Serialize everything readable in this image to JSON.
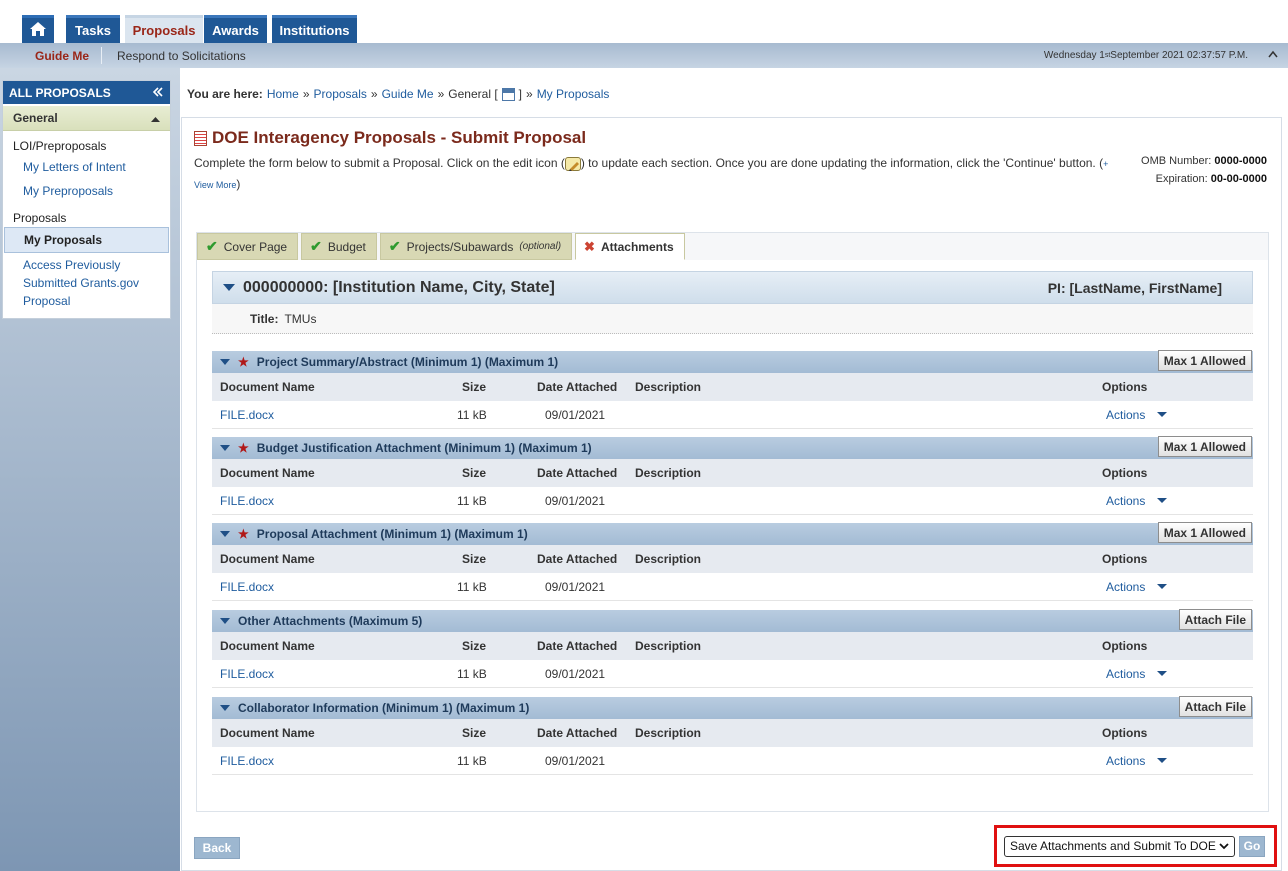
{
  "topnav": {
    "tabs": [
      {
        "label": "Tasks"
      },
      {
        "label": "Proposals"
      },
      {
        "label": "Awards"
      },
      {
        "label": "Institutions"
      }
    ]
  },
  "subnav": {
    "guide_me": "Guide Me",
    "respond": "Respond to Solicitations",
    "date_prefix": "Wednesday 1",
    "date_sup": "st",
    "date_suffix": " September 2021 02:37:57 P.M."
  },
  "sidebar": {
    "header": "ALL PROPOSALS",
    "section": "General",
    "groups": [
      {
        "label": "LOI/Preproposals",
        "links": [
          "My Letters of Intent",
          "My Preproposals"
        ]
      },
      {
        "label": "Proposals",
        "links": [
          "My Proposals",
          "Access Previously Submitted Grants.gov Proposal"
        ]
      }
    ]
  },
  "breadcrumb": {
    "label": "You are here:",
    "items": [
      "Home",
      "Proposals",
      "Guide Me"
    ],
    "general": "General [",
    "general_close": "]",
    "last": "My Proposals",
    "sep": "»"
  },
  "page": {
    "title": "DOE Interagency Proposals - Submit Proposal",
    "intro_part1": "Complete the form below to submit a Proposal. Click on the edit icon (",
    "intro_part2": ") to update each section. Once you are done updating the information, click the 'Continue' button. (",
    "intro_plus": "+",
    "view_more": "View More",
    "intro_close": ")",
    "omb_label": "OMB Number:",
    "omb_value": "0000-0000",
    "exp_label": "Expiration:",
    "exp_value": "00-00-0000"
  },
  "tabs": [
    {
      "label": "Cover Page",
      "status": "complete"
    },
    {
      "label": "Budget",
      "status": "complete"
    },
    {
      "label": "Projects/Subawards",
      "suffix": "(optional)",
      "status": "complete"
    },
    {
      "label": "Attachments",
      "status": "active"
    }
  ],
  "institution": {
    "name": "000000000: [Institution Name, City, State]",
    "pi": "PI: [LastName, FirstName]",
    "title_label": "Title:",
    "title_value": "TMUs"
  },
  "columns": {
    "name": "Document Name",
    "size": "Size",
    "date": "Date Attached",
    "desc": "Description",
    "options": "Options"
  },
  "sections": [
    {
      "title": "Project Summary/Abstract (Minimum 1) (Maximum 1)",
      "required": true,
      "button": "Max 1 Allowed",
      "file": "FILE.docx",
      "size": "11 kB",
      "date": "09/01/2021",
      "action": "Actions"
    },
    {
      "title": "Budget Justification Attachment (Minimum 1) (Maximum 1)",
      "required": true,
      "button": "Max 1 Allowed",
      "file": "FILE.docx",
      "size": "11 kB",
      "date": "09/01/2021",
      "action": "Actions"
    },
    {
      "title": "Proposal Attachment (Minimum 1) (Maximum 1)",
      "required": true,
      "button": "Max 1 Allowed",
      "file": "FILE.docx",
      "size": "11 kB",
      "date": "09/01/2021",
      "action": "Actions"
    },
    {
      "title": "Other Attachments (Maximum 5)",
      "required": false,
      "button": "Attach File",
      "file": "FILE.docx",
      "size": "11 kB",
      "date": "09/01/2021",
      "action": "Actions"
    },
    {
      "title": "Collaborator Information (Minimum 1) (Maximum 1)",
      "required": false,
      "button": "Attach File",
      "file": "FILE.docx",
      "size": "11 kB",
      "date": "09/01/2021",
      "action": "Actions"
    }
  ],
  "footer": {
    "back": "Back",
    "submit_option": "Save Attachments and Submit To DOE",
    "go": "Go"
  },
  "colors": {
    "nav_blue": "#1f5896",
    "title_red": "#7b2a1c",
    "highlight": "#e01010"
  }
}
